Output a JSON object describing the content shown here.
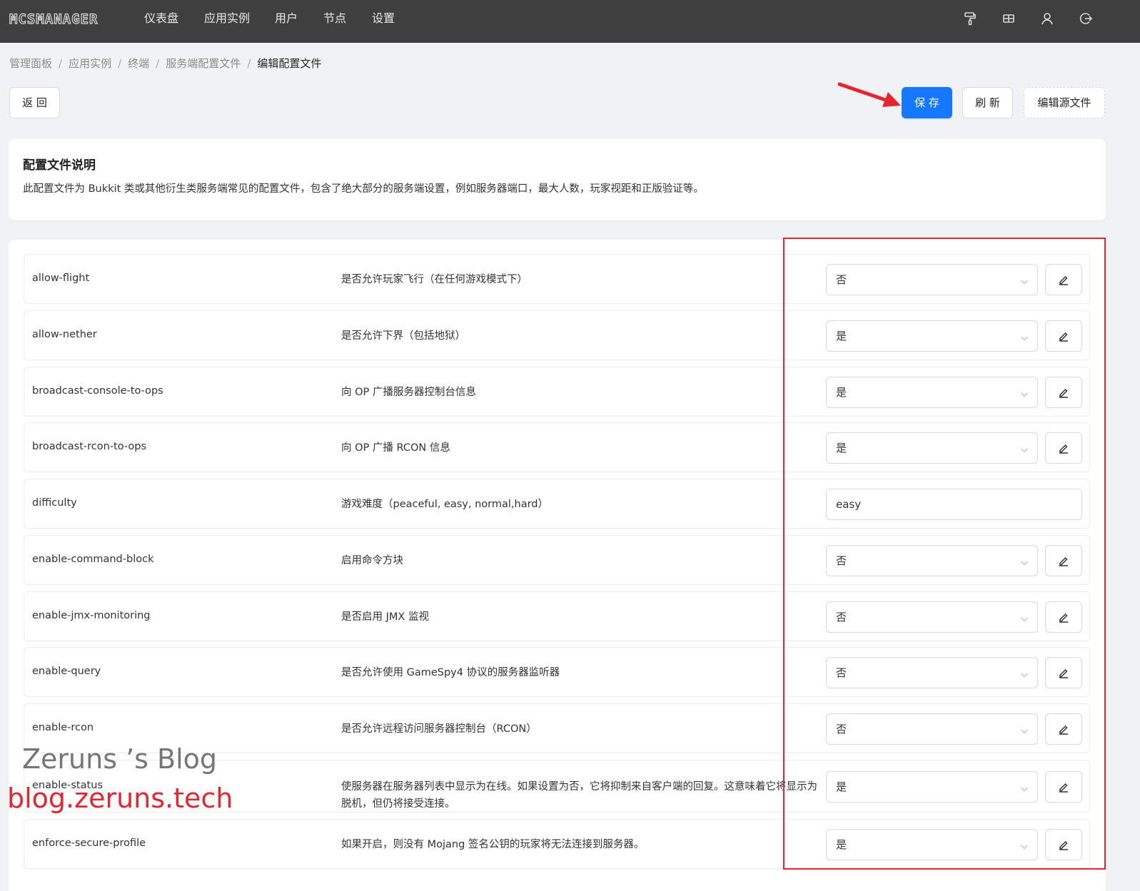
{
  "brand": {
    "logo": "MCSMANAGER"
  },
  "nav": [
    "仪表盘",
    "应用实例",
    "用户",
    "节点",
    "设置"
  ],
  "breadcrumb": [
    "管理面板",
    "应用实例",
    "终端",
    "服务端配置文件",
    "编辑配置文件"
  ],
  "breadcrumb_sep": "/",
  "actions": {
    "back": "返 回",
    "save": "保 存",
    "refresh": "刷 新",
    "edit_source": "编辑源文件"
  },
  "info": {
    "title": "配置文件说明",
    "text": "此配置文件为 Bukkit 类或其他衍生类服务端常见的配置文件，包含了绝大部分的服务端设置，例如服务器端口，最大人数，玩家视距和正版验证等。"
  },
  "settings": [
    {
      "key": "allow-flight",
      "desc": "是否允许玩家飞行（在任何游戏模式下）",
      "type": "select",
      "value": "否"
    },
    {
      "key": "allow-nether",
      "desc": "是否允许下界（包括地狱）",
      "type": "select",
      "value": "是"
    },
    {
      "key": "broadcast-console-to-ops",
      "desc": "向 OP 广播服务器控制台信息",
      "type": "select",
      "value": "是"
    },
    {
      "key": "broadcast-rcon-to-ops",
      "desc": "向 OP 广播 RCON 信息",
      "type": "select",
      "value": "是"
    },
    {
      "key": "difficulty",
      "desc": "游戏难度（peaceful, easy, normal,hard）",
      "type": "input",
      "value": "easy"
    },
    {
      "key": "enable-command-block",
      "desc": "启用命令方块",
      "type": "select",
      "value": "否"
    },
    {
      "key": "enable-jmx-monitoring",
      "desc": "是否启用 JMX 监视",
      "type": "select",
      "value": "否"
    },
    {
      "key": "enable-query",
      "desc": "是否允许使用 GameSpy4 协议的服务器监听器",
      "type": "select",
      "value": "否"
    },
    {
      "key": "enable-rcon",
      "desc": "是否允许远程访问服务器控制台（RCON）",
      "type": "select",
      "value": "否"
    },
    {
      "key": "enable-status",
      "desc": "使服务器在服务器列表中显示为在线。如果设置为否，它将抑制来自客户端的回复。这意味着它将显示为脱机，但仍将接受连接。",
      "type": "select",
      "value": "是"
    },
    {
      "key": "enforce-secure-profile",
      "desc": "如果开启，则没有 Mojang 签名公钥的玩家将无法连接到服务器。",
      "type": "select",
      "value": "是"
    }
  ],
  "watermark": {
    "line1": "Zeruns ’s Blog",
    "line2": "blog.zeruns.tech"
  },
  "colors": {
    "primary": "#1677ff",
    "topbar": "#3f3f3f",
    "annotation": "#e5252f"
  }
}
